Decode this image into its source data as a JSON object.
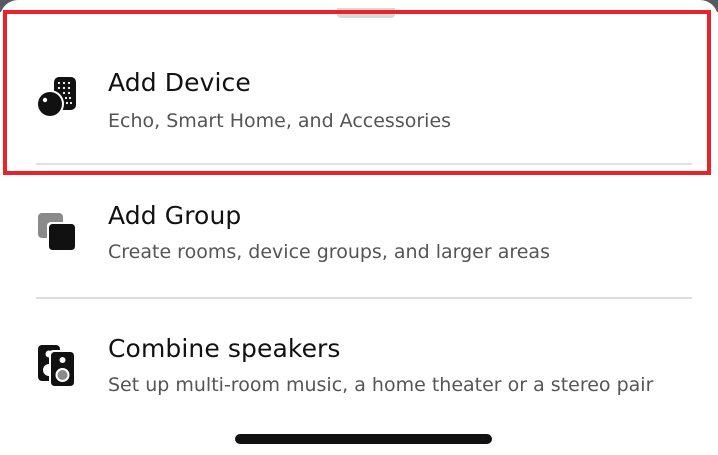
{
  "menu": {
    "items": [
      {
        "title": "Add Device",
        "subtitle": "Echo, Smart Home, and Accessories",
        "icon": "echo-device-icon"
      },
      {
        "title": "Add Group",
        "subtitle": "Create rooms, device groups, and larger areas",
        "icon": "group-squares-icon"
      },
      {
        "title": "Combine speakers",
        "subtitle": "Set up multi-room music, a home theater or a stereo pair",
        "icon": "speakers-icon"
      }
    ]
  },
  "colors": {
    "highlight": "#e8232b",
    "title_text": "#111111",
    "subtitle_text": "#555555",
    "icon": "#111111"
  }
}
